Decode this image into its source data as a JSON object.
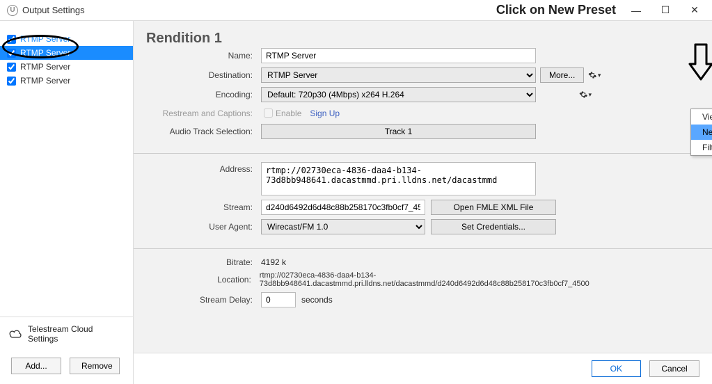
{
  "titlebar": {
    "title": "Output Settings",
    "instruction": "Click on New Preset"
  },
  "sidebar": {
    "items": [
      {
        "label": "RTMP Server",
        "checked": true,
        "selected": false
      },
      {
        "label": "RTMP Server",
        "checked": true,
        "selected": true
      },
      {
        "label": "RTMP Server",
        "checked": true,
        "selected": false
      },
      {
        "label": "RTMP Server",
        "checked": true,
        "selected": false
      }
    ],
    "cloud_settings": "Telestream Cloud Settings",
    "add_btn": "Add...",
    "remove_btn": "Remove"
  },
  "form": {
    "heading": "Rendition 1",
    "labels": {
      "name": "Name:",
      "destination": "Destination:",
      "encoding": "Encoding:",
      "restream": "Restream and Captions:",
      "audio": "Audio Track Selection:",
      "address": "Address:",
      "stream": "Stream:",
      "user_agent": "User Agent:",
      "bitrate": "Bitrate:",
      "location": "Location:",
      "stream_delay": "Stream Delay:"
    },
    "name_value": "RTMP Server",
    "destination_value": "RTMP Server",
    "encoding_value": "Default: 720p30 (4Mbps) x264 H.264",
    "more_btn": "More...",
    "enable_label": "Enable",
    "signup_link": "Sign Up",
    "track_btn": "Track 1",
    "address_value": "rtmp://02730eca-4836-daa4-b134-73d8bb948641.dacastmmd.pri.lldns.net/dacastmmd",
    "stream_value": "d240d6492d6d48c88b258170c3fb0cf7_4500",
    "open_fmle_btn": "Open FMLE XML File",
    "user_agent_value": "Wirecast/FM 1.0",
    "set_cred_btn": "Set Credentials...",
    "bitrate_value": "4192 k",
    "location_value": "rtmp://02730eca-4836-daa4-b134-73d8bb948641.dacastmmd.pri.lldns.net/dacastmmd/d240d6492d6d48c88b258170c3fb0cf7_4500",
    "delay_value": "0",
    "delay_unit": "seconds"
  },
  "menu": {
    "items": [
      "View Details...",
      "New Preset",
      "Filter..."
    ],
    "highlighted_index": 1
  },
  "footer": {
    "ok": "OK",
    "cancel": "Cancel"
  }
}
